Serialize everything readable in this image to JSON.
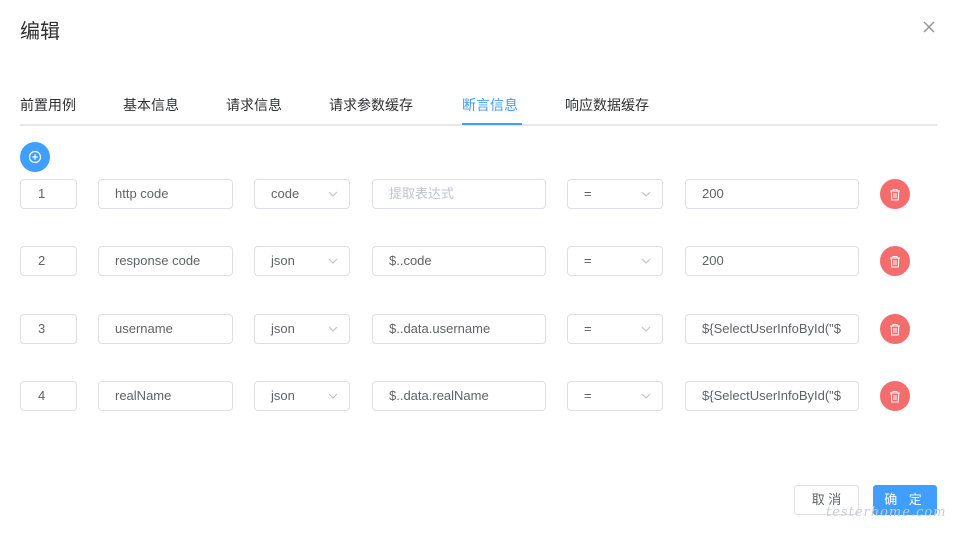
{
  "dialog": {
    "title": "编辑"
  },
  "tabs": [
    {
      "label": "前置用例",
      "active": false
    },
    {
      "label": "基本信息",
      "active": false
    },
    {
      "label": "请求信息",
      "active": false
    },
    {
      "label": "请求参数缓存",
      "active": false
    },
    {
      "label": "断言信息",
      "active": true
    },
    {
      "label": "响应数据缓存",
      "active": false
    }
  ],
  "rows": [
    {
      "index": "1",
      "name": "http code",
      "type": "code",
      "expression": "",
      "expression_placeholder": "提取表达式",
      "operator": "=",
      "expected": "200"
    },
    {
      "index": "2",
      "name": "response code",
      "type": "json",
      "expression": "$..code",
      "expression_placeholder": "",
      "operator": "=",
      "expected": "200"
    },
    {
      "index": "3",
      "name": "username",
      "type": "json",
      "expression": "$..data.username",
      "expression_placeholder": "",
      "operator": "=",
      "expected": "${SelectUserInfoById(\"$"
    },
    {
      "index": "4",
      "name": "realName",
      "type": "json",
      "expression": "$..data.realName",
      "expression_placeholder": "",
      "operator": "=",
      "expected": "${SelectUserInfoById(\"$"
    }
  ],
  "footer": {
    "cancel_label": "取 消",
    "ok_label": "确 定"
  },
  "watermark": "testerhome.com",
  "colors": {
    "primary": "#409eff",
    "danger": "#f56c6c",
    "border": "#dcdfe6"
  }
}
